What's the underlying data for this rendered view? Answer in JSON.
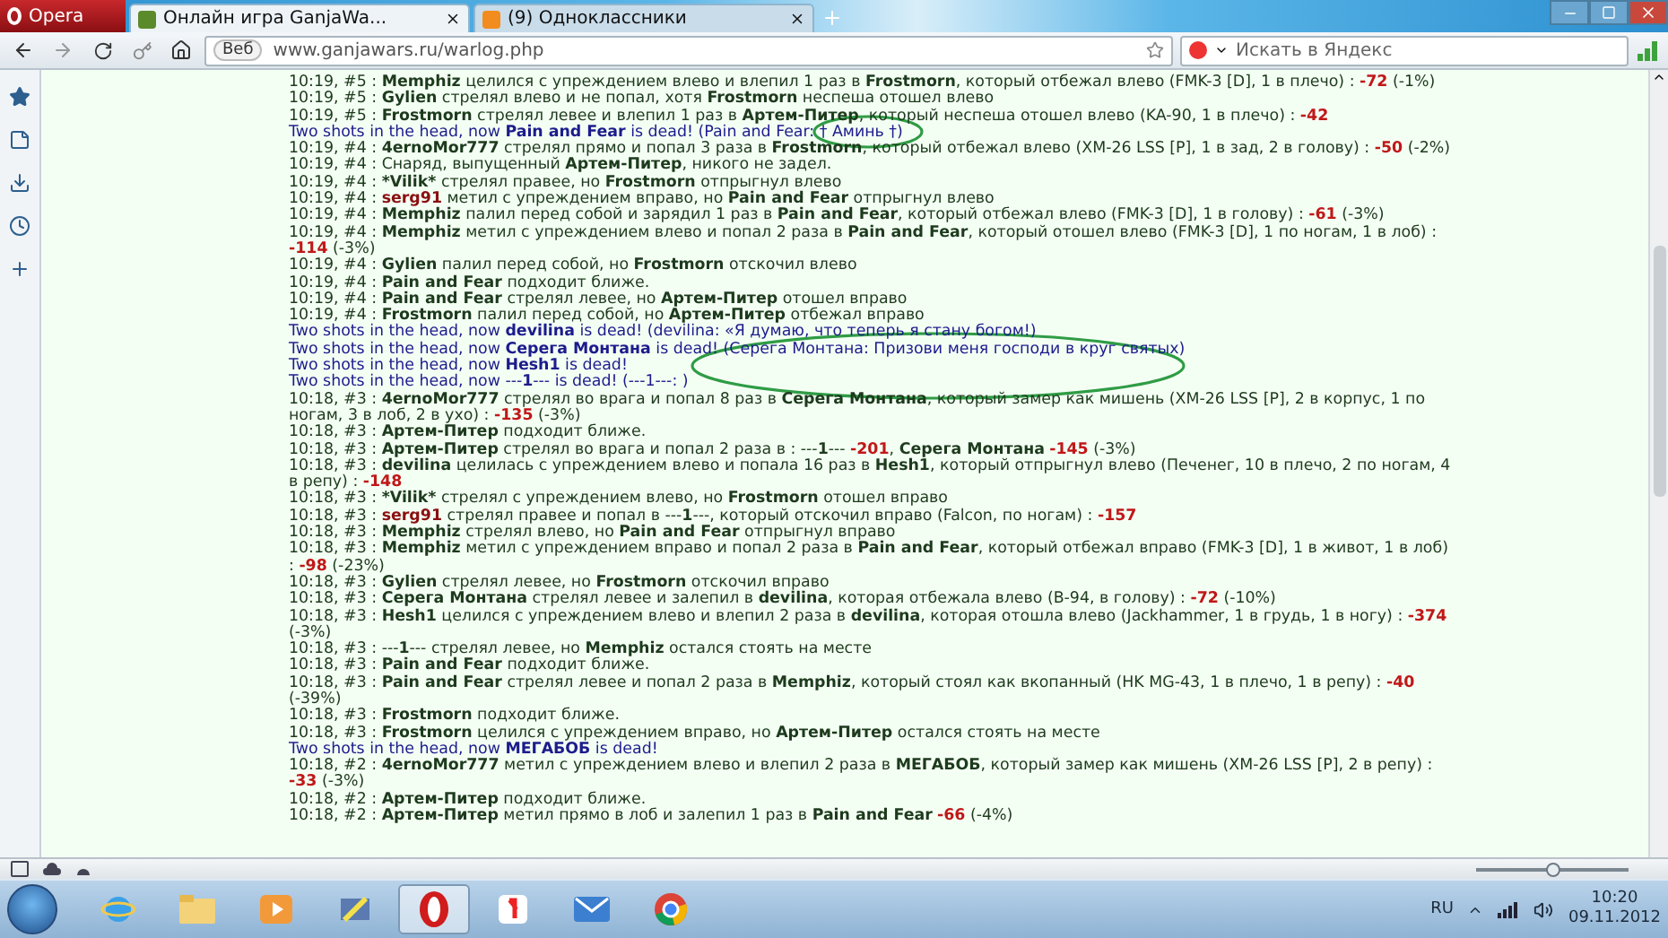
{
  "browser": {
    "menu_button": "Opera",
    "tabs": [
      {
        "label": "Онлайн игра GanjaWa...",
        "selected": true,
        "kind": "game"
      },
      {
        "label": "(9) Одноклассники",
        "selected": false,
        "kind": "ok"
      }
    ],
    "web_badge": "Веб",
    "url": "www.ganjawars.ru/warlog.php",
    "search": {
      "placeholder": "Искать в Яндекс"
    },
    "zoom_slider": {
      "level": 0.5
    }
  },
  "log": [
    {
      "kind": "event",
      "parts": [
        {
          "text": "10:19, #5 : ",
          "kind": "plain"
        },
        {
          "text": "Memphiz",
          "kind": "name"
        },
        {
          "text": " целился с упреждением влево и влепил 1 раз в ",
          "kind": "plain"
        },
        {
          "text": "Frostmorn",
          "kind": "name"
        },
        {
          "text": ", который отбежал влево (FMK-3 [D], 1 в плечо) : ",
          "kind": "plain"
        },
        {
          "text": "-72",
          "kind": "damage"
        },
        {
          "text": " (-1%)",
          "kind": "plain"
        }
      ]
    },
    {
      "kind": "event",
      "parts": [
        {
          "text": "10:19, #5 : ",
          "kind": "plain"
        },
        {
          "text": "Gylien",
          "kind": "name"
        },
        {
          "text": " стрелял влево и не попал, хотя ",
          "kind": "plain"
        },
        {
          "text": "Frostmorn",
          "kind": "name"
        },
        {
          "text": " неспеша отошел влево",
          "kind": "plain"
        }
      ]
    },
    {
      "kind": "event",
      "parts": [
        {
          "text": "10:19, #5 : ",
          "kind": "plain"
        },
        {
          "text": "Frostmorn",
          "kind": "name"
        },
        {
          "text": " стрелял левее и влепил 1 раз в ",
          "kind": "plain"
        },
        {
          "text": "Артем-Питер",
          "kind": "name"
        },
        {
          "text": ", который неспеша отошел влево (KA-90, 1 в плечо) : ",
          "kind": "plain"
        },
        {
          "text": "-42",
          "kind": "damage"
        }
      ]
    },
    {
      "kind": "kill",
      "parts": [
        {
          "text": "Two shots in the head, now ",
          "kind": "plain"
        },
        {
          "text": "Pain and Fear",
          "kind": "name"
        },
        {
          "text": " is dead! (Pain and Fear: † Аминь †)",
          "kind": "plain"
        }
      ]
    },
    {
      "kind": "event",
      "parts": [
        {
          "text": "10:19, #4 : ",
          "kind": "plain"
        },
        {
          "text": "4ernoMor777",
          "kind": "name"
        },
        {
          "text": " стрелял прямо и попал 3 раза в ",
          "kind": "plain"
        },
        {
          "text": "Frostmorn",
          "kind": "name"
        },
        {
          "text": ", который отбежал влево (XM-26 LSS [P], 1 в зад, 2 в голову) : ",
          "kind": "plain"
        },
        {
          "text": "-50",
          "kind": "damage"
        },
        {
          "text": " (-2%)",
          "kind": "plain"
        }
      ]
    },
    {
      "kind": "event",
      "parts": [
        {
          "text": "10:19, #4 : Снаряд, выпущенный ",
          "kind": "plain"
        },
        {
          "text": "Артем-Питер",
          "kind": "name"
        },
        {
          "text": ", никого не задел.",
          "kind": "plain"
        }
      ]
    },
    {
      "kind": "event",
      "parts": [
        {
          "text": "10:19, #4 : ",
          "kind": "plain"
        },
        {
          "text": "*Vilik*",
          "kind": "name"
        },
        {
          "text": " стрелял правее, но ",
          "kind": "plain"
        },
        {
          "text": "Frostmorn",
          "kind": "name"
        },
        {
          "text": " отпрыгнул влево",
          "kind": "plain"
        }
      ]
    },
    {
      "kind": "event",
      "parts": [
        {
          "text": "10:19, #4 : ",
          "kind": "plain"
        },
        {
          "text": "serg91",
          "kind": "enemy"
        },
        {
          "text": " метил с упреждением вправо, но ",
          "kind": "plain"
        },
        {
          "text": "Pain and Fear",
          "kind": "name"
        },
        {
          "text": " отпрыгнул влево",
          "kind": "plain"
        }
      ]
    },
    {
      "kind": "event",
      "parts": [
        {
          "text": "10:19, #4 : ",
          "kind": "plain"
        },
        {
          "text": "Memphiz",
          "kind": "name"
        },
        {
          "text": " палил перед собой и зарядил 1 раз в ",
          "kind": "plain"
        },
        {
          "text": "Pain and Fear",
          "kind": "name"
        },
        {
          "text": ", который отбежал влево (FMK-3 [D], 1 в голову) : ",
          "kind": "plain"
        },
        {
          "text": "-61",
          "kind": "damage"
        },
        {
          "text": " (-3%)",
          "kind": "plain"
        }
      ]
    },
    {
      "kind": "event",
      "parts": [
        {
          "text": "10:19, #4 : ",
          "kind": "plain"
        },
        {
          "text": "Memphiz",
          "kind": "name"
        },
        {
          "text": " метил с упреждением влево и попал 2 раза в ",
          "kind": "plain"
        },
        {
          "text": "Pain and Fear",
          "kind": "name"
        },
        {
          "text": ", который отошел влево (FMK-3 [D], 1 по ногам, 1 в лоб) : ",
          "kind": "plain"
        },
        {
          "text": "-114",
          "kind": "damage"
        },
        {
          "text": " (-3%)",
          "kind": "plain"
        }
      ]
    },
    {
      "kind": "event",
      "parts": [
        {
          "text": "10:19, #4 : ",
          "kind": "plain"
        },
        {
          "text": "Gylien",
          "kind": "name"
        },
        {
          "text": " палил перед собой, но ",
          "kind": "plain"
        },
        {
          "text": "Frostmorn",
          "kind": "name"
        },
        {
          "text": " отскочил влево",
          "kind": "plain"
        }
      ]
    },
    {
      "kind": "event",
      "parts": [
        {
          "text": "10:19, #4 : ",
          "kind": "plain"
        },
        {
          "text": "Pain and Fear",
          "kind": "name"
        },
        {
          "text": " подходит ближе.",
          "kind": "plain"
        }
      ]
    },
    {
      "kind": "event",
      "parts": [
        {
          "text": "10:19, #4 : ",
          "kind": "plain"
        },
        {
          "text": "Pain and Fear",
          "kind": "name"
        },
        {
          "text": " стрелял левее, но ",
          "kind": "plain"
        },
        {
          "text": "Артем-Питер",
          "kind": "name"
        },
        {
          "text": " отошел вправо",
          "kind": "plain"
        }
      ]
    },
    {
      "kind": "event",
      "parts": [
        {
          "text": "10:19, #4 : ",
          "kind": "plain"
        },
        {
          "text": "Frostmorn",
          "kind": "name"
        },
        {
          "text": " палил перед собой, но ",
          "kind": "plain"
        },
        {
          "text": "Артем-Питер",
          "kind": "name"
        },
        {
          "text": " отбежал вправо",
          "kind": "plain"
        }
      ]
    },
    {
      "kind": "kill",
      "parts": [
        {
          "text": "Two shots in the head, now ",
          "kind": "plain"
        },
        {
          "text": "devilina",
          "kind": "name"
        },
        {
          "text": " is dead! (devilina: «Я думаю, что теперь я стану богом!)",
          "kind": "plain"
        }
      ]
    },
    {
      "kind": "kill",
      "parts": [
        {
          "text": "Two shots in the head, now ",
          "kind": "plain"
        },
        {
          "text": "Серега Монтана",
          "kind": "name"
        },
        {
          "text": " is dead! (Серега Монтана: Призови меня господи в круг святых)",
          "kind": "plain"
        }
      ]
    },
    {
      "kind": "kill",
      "parts": [
        {
          "text": "Two shots in the head, now ",
          "kind": "plain"
        },
        {
          "text": "Hesh1",
          "kind": "name"
        },
        {
          "text": " is dead!",
          "kind": "plain"
        }
      ]
    },
    {
      "kind": "kill",
      "parts": [
        {
          "text": "Two shots in the head, now ---",
          "kind": "plain"
        },
        {
          "text": "1",
          "kind": "name"
        },
        {
          "text": "--- is dead! (---1---: )",
          "kind": "plain"
        }
      ]
    },
    {
      "kind": "event",
      "parts": [
        {
          "text": "10:18, #3 : ",
          "kind": "plain"
        },
        {
          "text": "4ernoMor777",
          "kind": "name"
        },
        {
          "text": " стрелял во врага и попал 8 раз в ",
          "kind": "plain"
        },
        {
          "text": "Серега Монтана",
          "kind": "name"
        },
        {
          "text": ", который замер как мишень (XM-26 LSS [P], 2 в корпус, 1 по ногам, 3 в лоб, 2 в ухо) : ",
          "kind": "plain"
        },
        {
          "text": "-135",
          "kind": "damage"
        },
        {
          "text": " (-3%)",
          "kind": "plain"
        }
      ]
    },
    {
      "kind": "event",
      "parts": [
        {
          "text": "10:18, #3 : ",
          "kind": "plain"
        },
        {
          "text": "Артем-Питер",
          "kind": "name"
        },
        {
          "text": " подходит ближе.",
          "kind": "plain"
        }
      ]
    },
    {
      "kind": "event",
      "parts": [
        {
          "text": "10:18, #3 : ",
          "kind": "plain"
        },
        {
          "text": "Артем-Питер",
          "kind": "name"
        },
        {
          "text": " стрелял во врага и попал 2 раза в : ---",
          "kind": "plain"
        },
        {
          "text": "1",
          "kind": "name"
        },
        {
          "text": "--- ",
          "kind": "plain"
        },
        {
          "text": "-201",
          "kind": "damage"
        },
        {
          "text": ", ",
          "kind": "plain"
        },
        {
          "text": "Серега Монтана",
          "kind": "name"
        },
        {
          "text": "-145",
          "kind": "damage"
        },
        {
          "text": " (-3%)",
          "kind": "plain"
        }
      ]
    },
    {
      "kind": "event",
      "parts": [
        {
          "text": "10:18, #3 : ",
          "kind": "plain"
        },
        {
          "text": "devilina",
          "kind": "name"
        },
        {
          "text": " целилась с упреждением влево и попала 16 раз в ",
          "kind": "plain"
        },
        {
          "text": "Hesh1",
          "kind": "name"
        },
        {
          "text": ", который отпрыгнул влево (Печенег, 10 в плечо, 2 по ногам, 4 в репу) : ",
          "kind": "plain"
        },
        {
          "text": "-148",
          "kind": "damage"
        }
      ]
    },
    {
      "kind": "event",
      "parts": [
        {
          "text": "10:18, #3 : ",
          "kind": "plain"
        },
        {
          "text": "*Vilik*",
          "kind": "name"
        },
        {
          "text": " стрелял с упреждением влево, но ",
          "kind": "plain"
        },
        {
          "text": "Frostmorn",
          "kind": "name"
        },
        {
          "text": " отошел вправо",
          "kind": "plain"
        }
      ]
    },
    {
      "kind": "event",
      "parts": [
        {
          "text": "10:18, #3 : ",
          "kind": "plain"
        },
        {
          "text": "serg91",
          "kind": "enemy"
        },
        {
          "text": " стрелял правее и попал в ---",
          "kind": "plain"
        },
        {
          "text": "1",
          "kind": "name"
        },
        {
          "text": "---, который отскочил вправо (Falcon, по ногам) : ",
          "kind": "plain"
        },
        {
          "text": "-157",
          "kind": "damage"
        }
      ]
    },
    {
      "kind": "event",
      "parts": [
        {
          "text": "10:18, #3 : ",
          "kind": "plain"
        },
        {
          "text": "Memphiz",
          "kind": "name"
        },
        {
          "text": " стрелял влево, но ",
          "kind": "plain"
        },
        {
          "text": "Pain and Fear",
          "kind": "name"
        },
        {
          "text": " отпрыгнул вправо",
          "kind": "plain"
        }
      ]
    },
    {
      "kind": "event",
      "parts": [
        {
          "text": "10:18, #3 : ",
          "kind": "plain"
        },
        {
          "text": "Memphiz",
          "kind": "name"
        },
        {
          "text": " метил с упреждением вправо и попал 2 раза в ",
          "kind": "plain"
        },
        {
          "text": "Pain and Fear",
          "kind": "name"
        },
        {
          "text": ", который отбежал вправо (FMK-3 [D], 1 в живот, 1 в лоб) : ",
          "kind": "plain"
        },
        {
          "text": "-98",
          "kind": "damage"
        },
        {
          "text": " (-23%)",
          "kind": "plain"
        }
      ]
    },
    {
      "kind": "event",
      "parts": [
        {
          "text": "10:18, #3 : ",
          "kind": "plain"
        },
        {
          "text": "Gylien",
          "kind": "name"
        },
        {
          "text": " стрелял левее, но ",
          "kind": "plain"
        },
        {
          "text": "Frostmorn",
          "kind": "name"
        },
        {
          "text": " отскочил вправо",
          "kind": "plain"
        }
      ]
    },
    {
      "kind": "event",
      "parts": [
        {
          "text": "10:18, #3 : ",
          "kind": "plain"
        },
        {
          "text": "Серега Монтана",
          "kind": "name"
        },
        {
          "text": " стрелял левее и залепил в ",
          "kind": "plain"
        },
        {
          "text": "devilina",
          "kind": "name"
        },
        {
          "text": ", которая отбежала влево (B-94, в голову) : ",
          "kind": "plain"
        },
        {
          "text": "-72",
          "kind": "damage"
        },
        {
          "text": " (-10%)",
          "kind": "plain"
        }
      ]
    },
    {
      "kind": "event",
      "parts": [
        {
          "text": "10:18, #3 : ",
          "kind": "plain"
        },
        {
          "text": "Hesh1",
          "kind": "name"
        },
        {
          "text": " целился с упреждением влево и влепил 2 раза в ",
          "kind": "plain"
        },
        {
          "text": "devilina",
          "kind": "name"
        },
        {
          "text": ", которая отошла влево (Jackhammer, 1 в грудь, 1 в ногу) : ",
          "kind": "plain"
        },
        {
          "text": "-374",
          "kind": "damage"
        },
        {
          "text": " (-3%)",
          "kind": "plain"
        }
      ]
    },
    {
      "kind": "event",
      "parts": [
        {
          "text": "10:18, #3 : ---",
          "kind": "plain"
        },
        {
          "text": "1",
          "kind": "name"
        },
        {
          "text": "--- стрелял левее, но ",
          "kind": "plain"
        },
        {
          "text": "Memphiz",
          "kind": "name"
        },
        {
          "text": " остался стоять на месте",
          "kind": "plain"
        }
      ]
    },
    {
      "kind": "event",
      "parts": [
        {
          "text": "10:18, #3 : ",
          "kind": "plain"
        },
        {
          "text": "Pain and Fear",
          "kind": "name"
        },
        {
          "text": " подходит ближе.",
          "kind": "plain"
        }
      ]
    },
    {
      "kind": "event",
      "parts": [
        {
          "text": "10:18, #3 : ",
          "kind": "plain"
        },
        {
          "text": "Pain and Fear",
          "kind": "name"
        },
        {
          "text": " стрелял левее и попал 2 раза в ",
          "kind": "plain"
        },
        {
          "text": "Memphiz",
          "kind": "name"
        },
        {
          "text": ", который стоял как вкопанный (HK MG-43, 1 в плечо, 1 в репу) : ",
          "kind": "plain"
        },
        {
          "text": "-40",
          "kind": "damage"
        },
        {
          "text": " (-39%)",
          "kind": "plain"
        }
      ]
    },
    {
      "kind": "event",
      "parts": [
        {
          "text": "10:18, #3 : ",
          "kind": "plain"
        },
        {
          "text": "Frostmorn",
          "kind": "name"
        },
        {
          "text": " подходит ближе.",
          "kind": "plain"
        }
      ]
    },
    {
      "kind": "event",
      "parts": [
        {
          "text": "10:18, #3 : ",
          "kind": "plain"
        },
        {
          "text": "Frostmorn",
          "kind": "name"
        },
        {
          "text": " целился с упреждением вправо, но ",
          "kind": "plain"
        },
        {
          "text": "Артем-Питер",
          "kind": "name"
        },
        {
          "text": " остался стоять на месте",
          "kind": "plain"
        }
      ]
    },
    {
      "kind": "kill",
      "parts": [
        {
          "text": "Two shots in the head, now ",
          "kind": "plain"
        },
        {
          "text": "МЕГАБОБ",
          "kind": "name"
        },
        {
          "text": " is dead!",
          "kind": "plain"
        }
      ]
    },
    {
      "kind": "event",
      "parts": [
        {
          "text": "10:18, #2 : ",
          "kind": "plain"
        },
        {
          "text": "4ernoMor777",
          "kind": "name"
        },
        {
          "text": " метил с упреждением влево и влепил 2 раза в ",
          "kind": "plain"
        },
        {
          "text": "МЕГАБОБ",
          "kind": "name"
        },
        {
          "text": ", который замер как мишень (XM-26 LSS [P], 2 в репу) : ",
          "kind": "plain"
        },
        {
          "text": "-33",
          "kind": "damage"
        },
        {
          "text": " (-3%)",
          "kind": "plain"
        }
      ]
    },
    {
      "kind": "event",
      "parts": [
        {
          "text": "10:18, #2 : ",
          "kind": "plain"
        },
        {
          "text": "Артем-Питер",
          "kind": "name"
        },
        {
          "text": " подходит ближе.",
          "kind": "plain"
        }
      ]
    },
    {
      "kind": "event",
      "parts": [
        {
          "text": "10:18, #2 : ",
          "kind": "plain"
        },
        {
          "text": "Артем-Питер",
          "kind": "name"
        },
        {
          "text": " метил прямо в лоб и залепил 1 раз в ",
          "kind": "plain"
        },
        {
          "text": "Pain and Fear",
          "kind": "name"
        },
        {
          "text": "-66",
          "kind": "damage"
        },
        {
          "text": " (-4%)",
          "kind": "plain"
        }
      ]
    }
  ],
  "annotations": [
    {
      "kind": "ellipse"
    },
    {
      "kind": "ellipse"
    }
  ],
  "taskbar": {
    "apps": [
      {
        "kind": "ie",
        "selected": false
      },
      {
        "kind": "folder",
        "selected": false
      },
      {
        "kind": "media",
        "selected": false
      },
      {
        "kind": "tool",
        "selected": false
      },
      {
        "kind": "opera",
        "selected": true
      },
      {
        "kind": "yandex",
        "selected": false
      },
      {
        "kind": "mail",
        "selected": false
      },
      {
        "kind": "chrome",
        "selected": false
      }
    ],
    "language": "RU",
    "time": "10:20",
    "date": "09.11.2012"
  }
}
